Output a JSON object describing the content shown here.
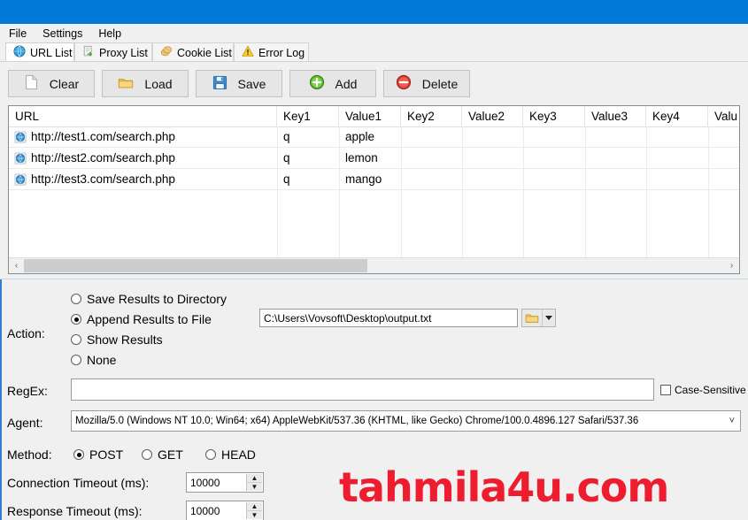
{
  "window": {
    "titlebar_color": "#0078d7",
    "background": "#f0f0f0"
  },
  "menubar": {
    "items": [
      {
        "label": "File"
      },
      {
        "label": "Settings"
      },
      {
        "label": "Help"
      }
    ]
  },
  "tabs": [
    {
      "label": "URL List",
      "icon": "globe-icon",
      "active": true
    },
    {
      "label": "Proxy List",
      "icon": "document-arrow-icon",
      "active": false
    },
    {
      "label": "Cookie List",
      "icon": "cookie-icon",
      "active": false
    },
    {
      "label": "Error Log",
      "icon": "warning-triangle-icon",
      "active": false
    }
  ],
  "toolbar": {
    "buttons": [
      {
        "label": "Clear",
        "icon": "blank-page-icon"
      },
      {
        "label": "Load",
        "icon": "folder-icon"
      },
      {
        "label": "Save",
        "icon": "floppy-disk-icon"
      },
      {
        "label": "Add",
        "icon": "green-plus-icon"
      },
      {
        "label": "Delete",
        "icon": "red-minus-icon"
      }
    ]
  },
  "table": {
    "columns": [
      "URL",
      "Key1",
      "Value1",
      "Key2",
      "Value2",
      "Key3",
      "Value3",
      "Key4",
      "Valu"
    ],
    "rows": [
      {
        "url": "http://test1.com/search.php",
        "key1": "q",
        "value1": "apple",
        "key2": "",
        "value2": "",
        "key3": "",
        "value3": "",
        "key4": "",
        "value4": ""
      },
      {
        "url": "http://test2.com/search.php",
        "key1": "q",
        "value1": "lemon",
        "key2": "",
        "value2": "",
        "key3": "",
        "value3": "",
        "key4": "",
        "value4": ""
      },
      {
        "url": "http://test3.com/search.php",
        "key1": "q",
        "value1": "mango",
        "key2": "",
        "value2": "",
        "key3": "",
        "value3": "",
        "key4": "",
        "value4": ""
      }
    ],
    "scrollbar": {
      "left_arrow": "‹",
      "right_arrow": "›"
    }
  },
  "action": {
    "label": "Action:",
    "options": [
      {
        "label": "Save Results to Directory",
        "selected": false
      },
      {
        "label": "Append Results to File",
        "selected": true
      },
      {
        "label": "Show Results",
        "selected": false
      },
      {
        "label": "None",
        "selected": false
      }
    ],
    "output_path": "C:\\Users\\Vovsoft\\Desktop\\output.txt",
    "browse_icon": "folder-icon",
    "dropdown_icon": "chevron-down-icon"
  },
  "regex": {
    "label": "RegEx:",
    "value": "",
    "case_sensitive_label": "Case-Sensitive",
    "case_sensitive_checked": false
  },
  "agent": {
    "label": "Agent:",
    "value": "Mozilla/5.0 (Windows NT 10.0; Win64; x64) AppleWebKit/537.36 (KHTML, like Gecko) Chrome/100.0.4896.127 Safari/537.36",
    "dropdown_icon": "chevron-down-icon"
  },
  "method": {
    "label": "Method:",
    "options": [
      {
        "label": "POST",
        "selected": true
      },
      {
        "label": "GET",
        "selected": false
      },
      {
        "label": "HEAD",
        "selected": false
      }
    ]
  },
  "timeouts": [
    {
      "label": "Connection Timeout (ms):",
      "value": "10000"
    },
    {
      "label": "Response Timeout (ms):",
      "value": "10000"
    }
  ],
  "watermark": {
    "text": "tahmila4u.com",
    "color": "#ed1c2e"
  }
}
